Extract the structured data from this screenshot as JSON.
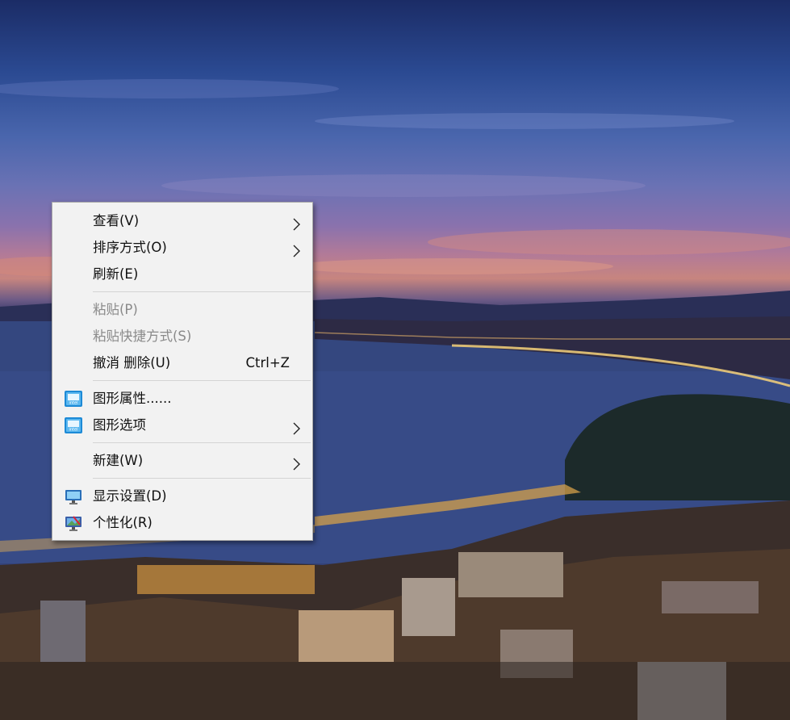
{
  "desktop": {
    "wallpaper": "city-coast-night-wallpaper"
  },
  "context_menu": {
    "groups": [
      {
        "items": [
          {
            "label": "查看(V)",
            "submenu": true
          },
          {
            "label": "排序方式(O)",
            "submenu": true
          },
          {
            "label": "刷新(E)"
          }
        ]
      },
      {
        "items": [
          {
            "label": "粘贴(P)",
            "disabled": true
          },
          {
            "label": "粘贴快捷方式(S)",
            "disabled": true
          },
          {
            "label": "撤消 删除(U)",
            "shortcut": "Ctrl+Z"
          }
        ]
      },
      {
        "items": [
          {
            "label": "图形属性......",
            "icon": "intel-graphics-icon"
          },
          {
            "label": "图形选项",
            "icon": "intel-graphics-icon",
            "submenu": true
          }
        ]
      },
      {
        "items": [
          {
            "label": "新建(W)",
            "submenu": true
          }
        ]
      },
      {
        "items": [
          {
            "label": "显示设置(D)",
            "icon": "display-settings-icon"
          },
          {
            "label": "个性化(R)",
            "icon": "personalize-icon"
          }
        ]
      }
    ]
  }
}
